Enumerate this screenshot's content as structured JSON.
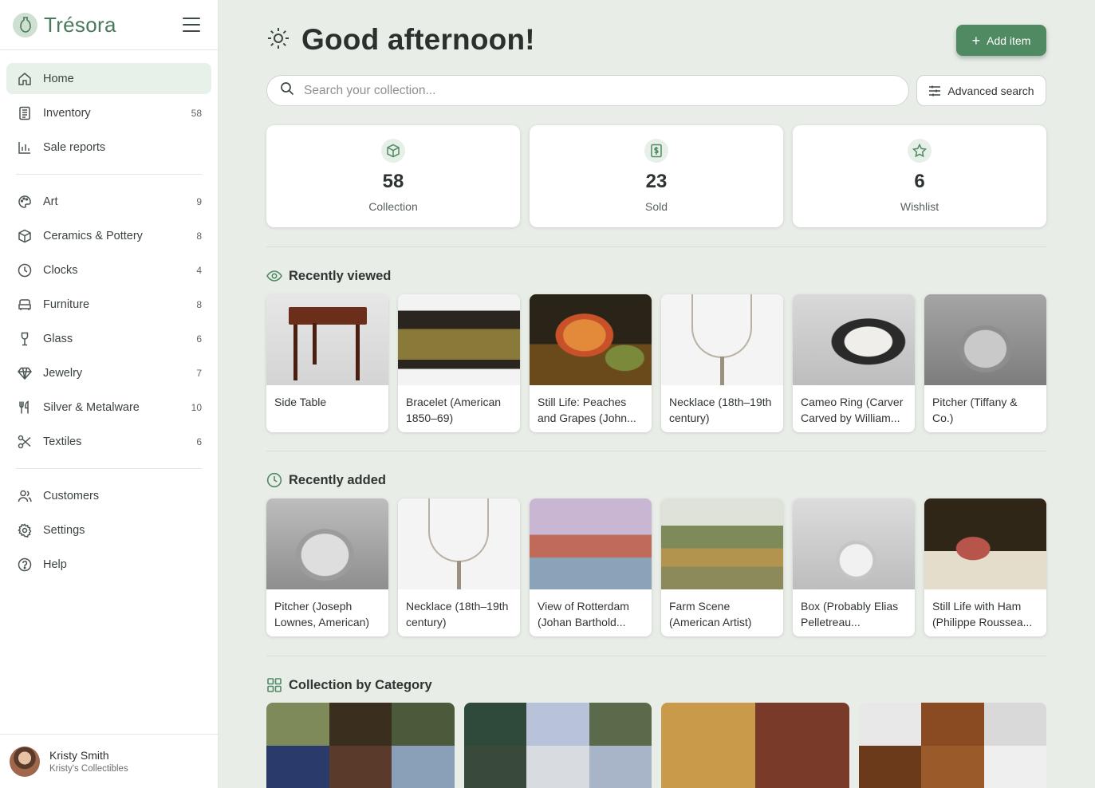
{
  "app": {
    "name": "Trésora"
  },
  "sidebar": {
    "primary": [
      {
        "label": "Home",
        "count": "",
        "icon": "home-icon"
      },
      {
        "label": "Inventory",
        "count": "58",
        "icon": "inventory-icon"
      },
      {
        "label": "Sale reports",
        "count": "",
        "icon": "bar-chart-icon"
      }
    ],
    "categories": [
      {
        "label": "Art",
        "count": "9",
        "icon": "palette-icon"
      },
      {
        "label": "Ceramics & Pottery",
        "count": "8",
        "icon": "box-icon"
      },
      {
        "label": "Clocks",
        "count": "4",
        "icon": "clock-icon"
      },
      {
        "label": "Furniture",
        "count": "8",
        "icon": "sofa-icon"
      },
      {
        "label": "Glass",
        "count": "6",
        "icon": "wine-glass-icon"
      },
      {
        "label": "Jewelry",
        "count": "7",
        "icon": "gem-icon"
      },
      {
        "label": "Silver & Metalware",
        "count": "10",
        "icon": "utensils-icon"
      },
      {
        "label": "Textiles",
        "count": "6",
        "icon": "scissors-icon"
      }
    ],
    "secondary": [
      {
        "label": "Customers",
        "icon": "users-icon"
      },
      {
        "label": "Settings",
        "icon": "gear-icon"
      },
      {
        "label": "Help",
        "icon": "help-icon"
      }
    ],
    "user": {
      "name": "Kristy Smith",
      "shop": "Kristy's Collectibles"
    }
  },
  "header": {
    "greeting": "Good afternoon!",
    "add_label": "Add item",
    "search_placeholder": "Search your collection...",
    "advanced_label": "Advanced search"
  },
  "stats": [
    {
      "value": "58",
      "label": "Collection",
      "icon": "cube-icon"
    },
    {
      "value": "23",
      "label": "Sold",
      "icon": "dollar-icon"
    },
    {
      "value": "6",
      "label": "Wishlist",
      "icon": "star-icon"
    }
  ],
  "recently_viewed": {
    "title": "Recently viewed",
    "items": [
      {
        "title": "Side Table"
      },
      {
        "title": "Bracelet (American 1850–69)"
      },
      {
        "title": "Still Life: Peaches and Grapes (John..."
      },
      {
        "title": "Necklace (18th–19th century)"
      },
      {
        "title": "Cameo Ring (Carver Carved by William..."
      },
      {
        "title": "Pitcher (Tiffany & Co.)"
      }
    ]
  },
  "recently_added": {
    "title": "Recently added",
    "items": [
      {
        "title": "Pitcher (Joseph Lownes, American)"
      },
      {
        "title": "Necklace (18th–19th century)"
      },
      {
        "title": "View of Rotterdam (Johan Barthold..."
      },
      {
        "title": "Farm Scene (American Artist)"
      },
      {
        "title": "Box (Probably Elias Pelletreau..."
      },
      {
        "title": "Still Life with Ham (Philippe Roussea..."
      }
    ]
  },
  "collection_by_category": {
    "title": "Collection by Category"
  },
  "colors": {
    "accent": "#4f8a62",
    "background": "#e9ede8",
    "active_nav": "#e8f0ea"
  }
}
